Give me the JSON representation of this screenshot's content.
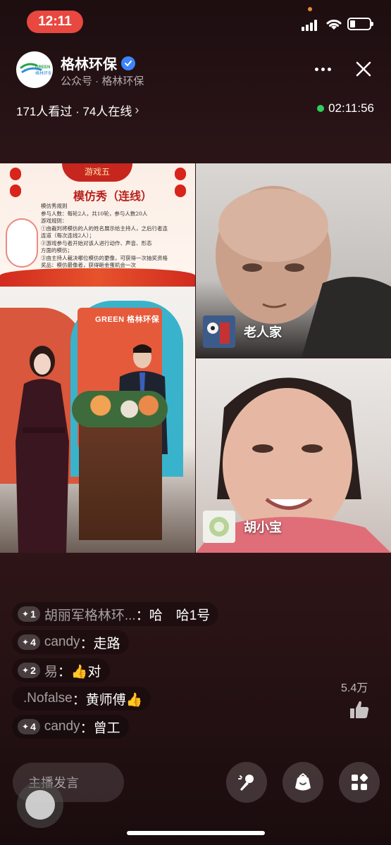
{
  "status_bar": {
    "time": "12:11"
  },
  "header": {
    "channel_name": "格林环保",
    "subtitle": "公众号 · 格林环保",
    "logo_text": "GREEN",
    "logo_subtext": "格林环保",
    "more_icon": "more-icon",
    "close_icon": "close-icon"
  },
  "stats": {
    "viewers_text": "171人看过 · 74人在线",
    "live_duration": "02:11:56"
  },
  "video": {
    "slide_banner": "游戏五",
    "slide_title": "模仿秀（连线）",
    "slide_lines": [
      "模仿秀规则",
      "参与人数：每轮2人，共10轮，参与人数20人",
      "游戏规则：",
      "①由裁判将模仿的人的姓名展示给主持人，之后行者连",
      "连道（每次连线2人）；",
      "②游戏参与者开始对该人进行动作、声音、形态",
      "方面的模仿；",
      "③由主持人裁决哪位模仿的更像，可获得一次抽奖资格",
      "奖品：模仿最像者，获得砸金蛋机会一次"
    ],
    "stage_board_text": "GREEN 格林环保",
    "participants": [
      {
        "name": "老人家"
      },
      {
        "name": "胡小宝"
      }
    ]
  },
  "comments": [
    {
      "level": "1",
      "user": "胡丽军格林环...",
      "text": "哈　哈1号"
    },
    {
      "level": "4",
      "user": "candy",
      "text": "走路"
    },
    {
      "level": "2",
      "user": "易",
      "text": "👍对"
    },
    {
      "level": "",
      "user": ".Nofalse",
      "text": "黄师傅👍"
    },
    {
      "level": "4",
      "user": "candy",
      "text": "曾工"
    }
  ],
  "likes": {
    "count": "5.4万"
  },
  "bottom_bar": {
    "host_input_placeholder": "主播发言",
    "mic_icon": "microphone-icon",
    "gift_icon": "gift-bag-icon",
    "apps_icon": "apps-icon"
  },
  "colors": {
    "time_pill": "#e8483f",
    "verified": "#3e84f7",
    "live_dot": "#2fcf5d"
  }
}
